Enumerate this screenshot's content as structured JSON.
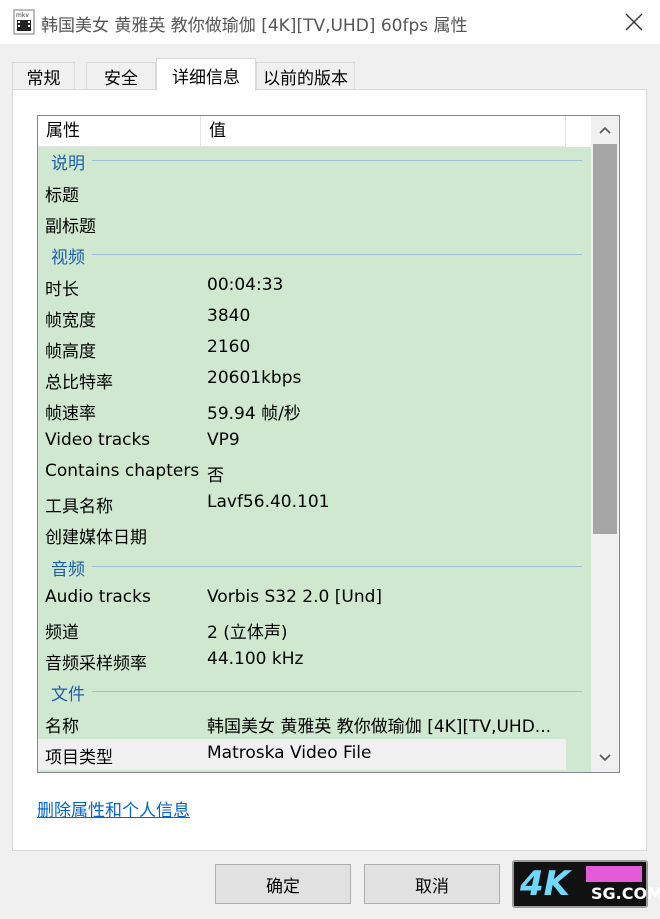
{
  "window": {
    "title": "韩国美女 黄雅英 教你做瑜伽 [4K][TV,UHD] 60fps 属性",
    "file_badge": "mkv"
  },
  "tabs": [
    {
      "label": "常规"
    },
    {
      "label": "安全"
    },
    {
      "label": "详细信息",
      "active": true
    },
    {
      "label": "以前的版本"
    }
  ],
  "list": {
    "col_property": "属性",
    "col_value": "值",
    "groups": {
      "description": "说明",
      "video": "视频",
      "audio": "音频",
      "file": "文件"
    },
    "rows": {
      "title": {
        "k": "标题",
        "v": ""
      },
      "subtitle": {
        "k": "副标题",
        "v": ""
      },
      "duration": {
        "k": "时长",
        "v": "00:04:33"
      },
      "width": {
        "k": "帧宽度",
        "v": "3840"
      },
      "height": {
        "k": "帧高度",
        "v": "2160"
      },
      "bitrate": {
        "k": "总比特率",
        "v": "20601kbps"
      },
      "framerate": {
        "k": "帧速率",
        "v": "59.94 帧/秒"
      },
      "video_tracks": {
        "k": "Video tracks",
        "v": "VP9"
      },
      "chapters": {
        "k": "Contains chapters",
        "v": "否"
      },
      "tool": {
        "k": "工具名称",
        "v": "Lavf56.40.101"
      },
      "media_created": {
        "k": "创建媒体日期",
        "v": ""
      },
      "audio_tracks": {
        "k": "Audio tracks",
        "v": "Vorbis S32 2.0 [Und]"
      },
      "channels": {
        "k": "频道",
        "v": "2 (立体声)"
      },
      "sample_rate": {
        "k": "音频采样频率",
        "v": "44.100 kHz"
      },
      "name": {
        "k": "名称",
        "v": "韩国美女 黄雅英 教你做瑜伽 [4K][TV,UHD..."
      },
      "item_type": {
        "k": "项目类型",
        "v": "Matroska Video File"
      }
    }
  },
  "link": "删除属性和个人信息",
  "buttons": {
    "ok": "确定",
    "cancel": "取消"
  },
  "watermark": {
    "big": "4K",
    "small": "SG.COM"
  },
  "colors": {
    "row_bg": "#cfe8cf",
    "group_text": "#1f5fa8",
    "link": "#0066cc"
  }
}
